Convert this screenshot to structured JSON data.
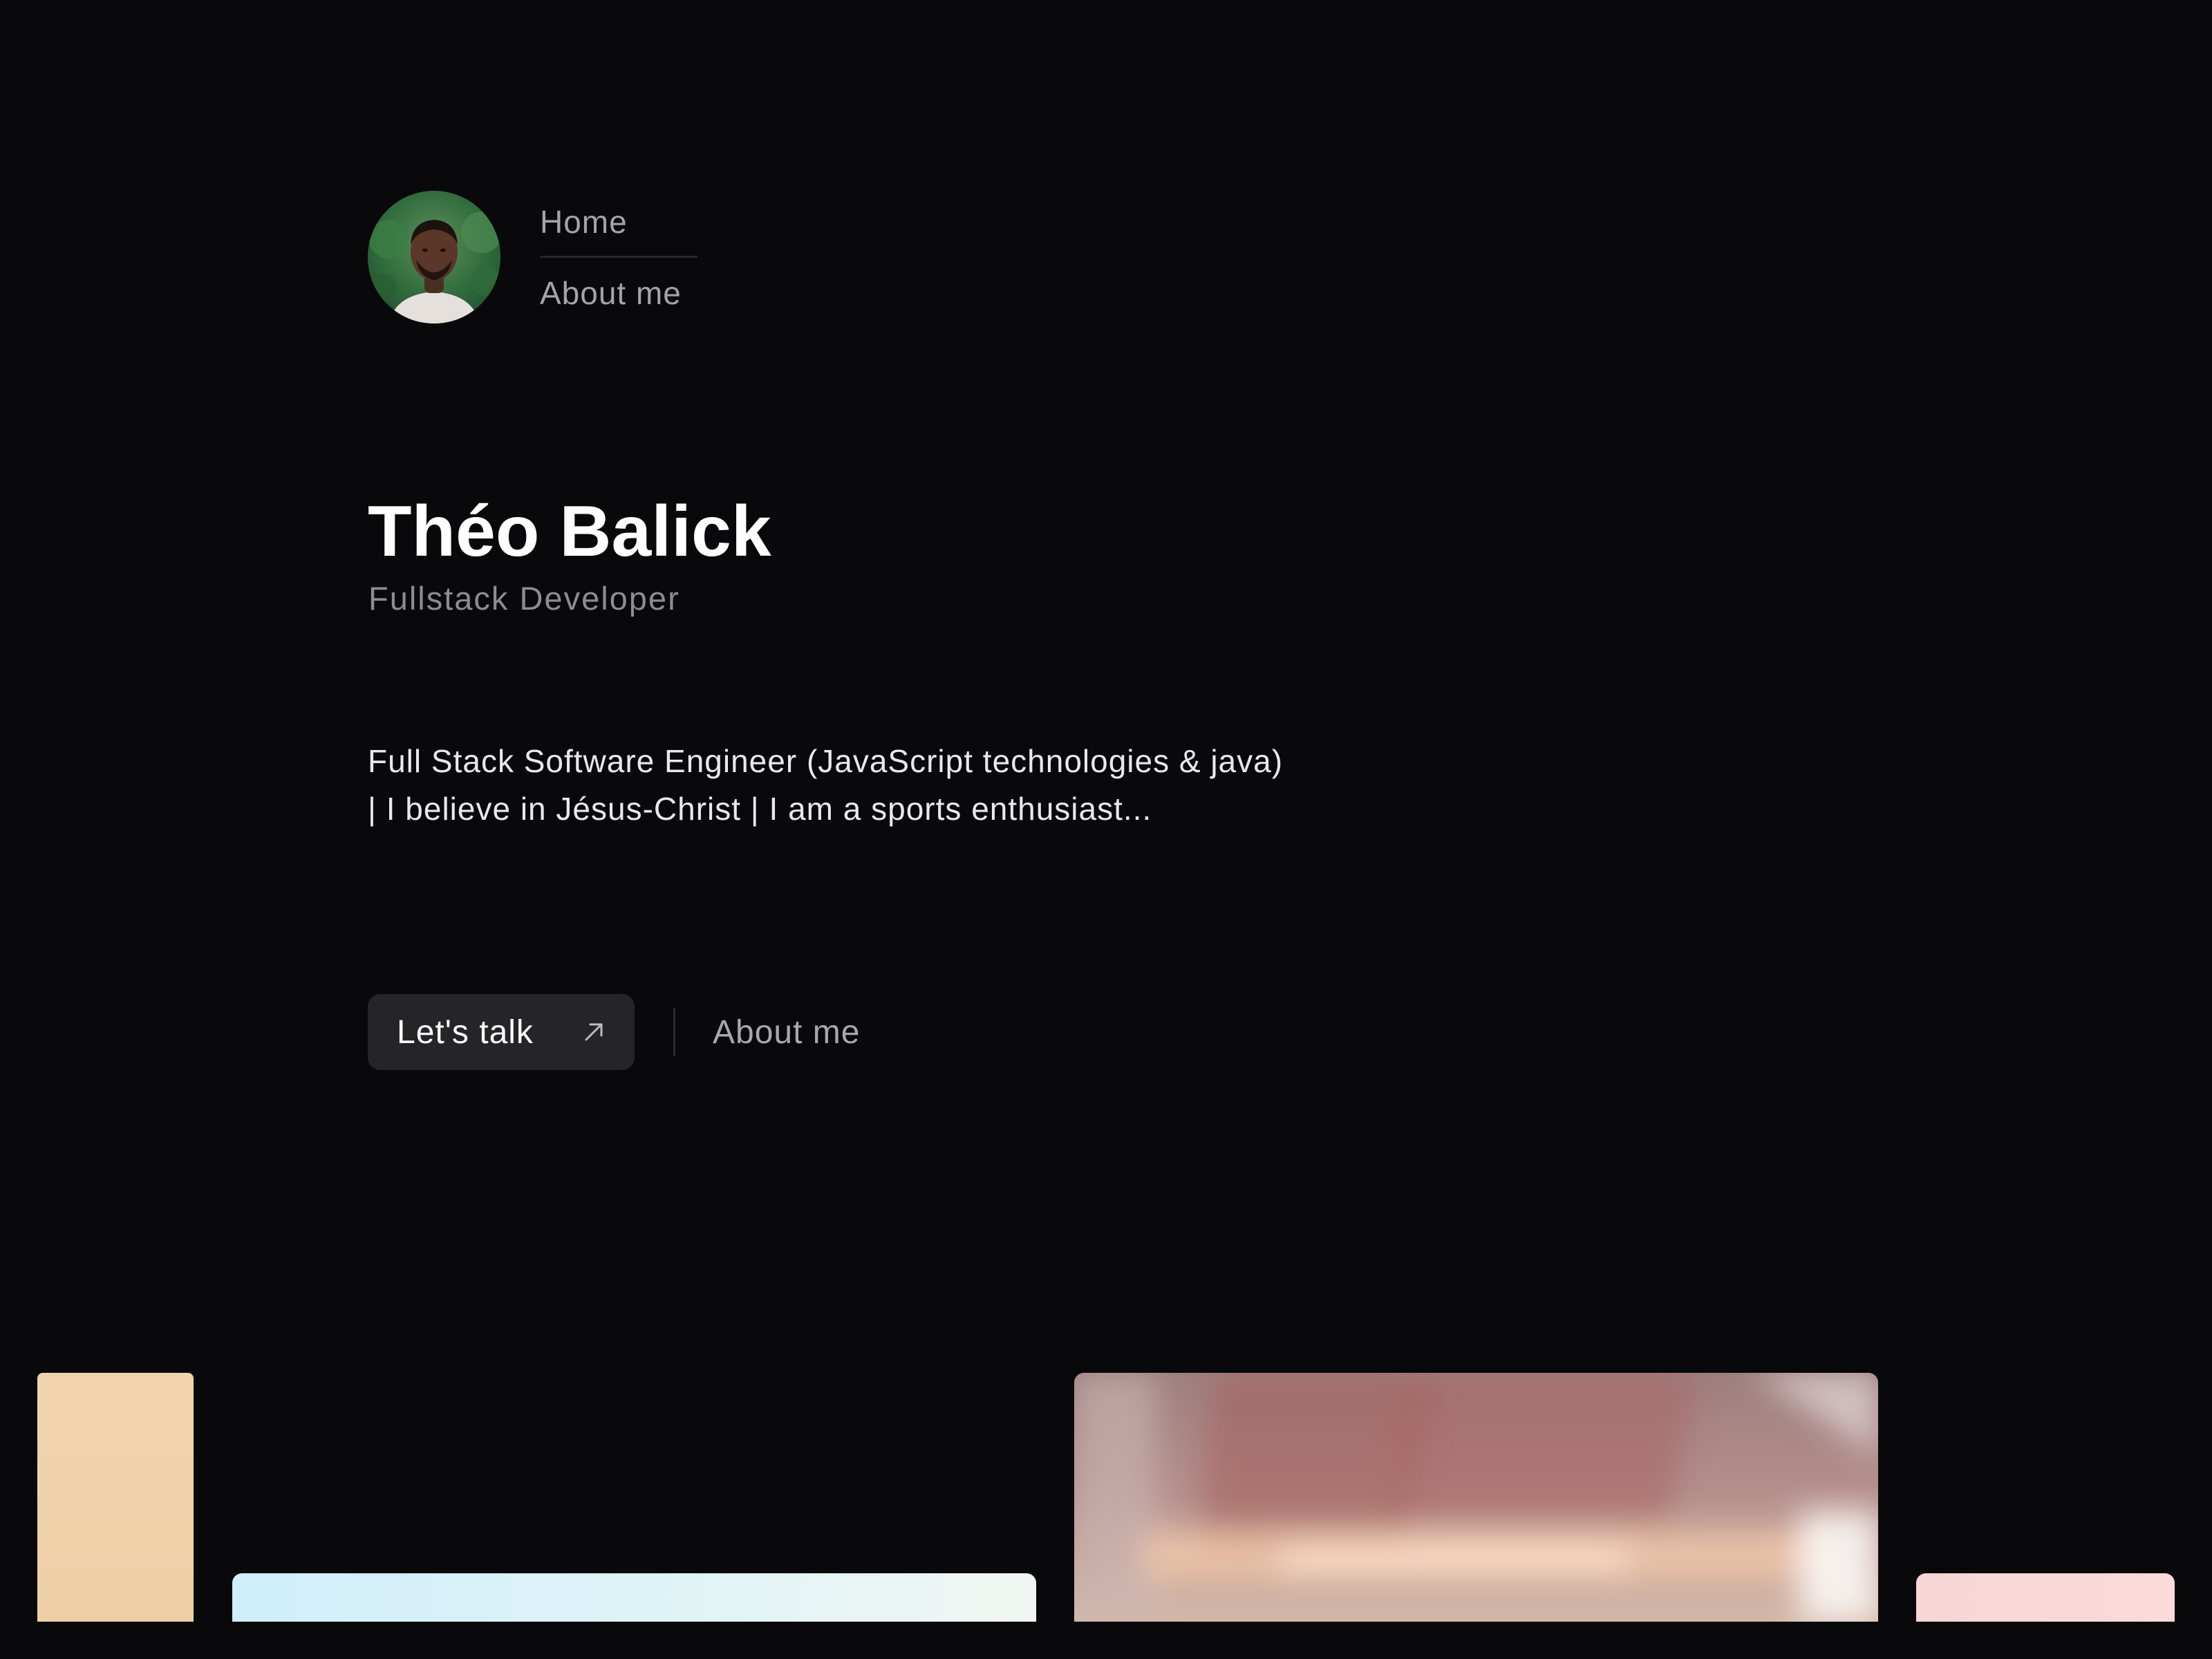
{
  "profile": {
    "avatar_alt": "Profile photo of Théo Balick"
  },
  "nav": {
    "items": [
      {
        "label": "Home"
      },
      {
        "label": "About me"
      }
    ]
  },
  "hero": {
    "name": "Théo Balick",
    "role": "Fullstack Developer",
    "bio": "Full Stack Software Engineer (JavaScript technologies & java) | I believe in Jésus-Christ | I am a sports enthusiast..."
  },
  "actions": {
    "primary_label": "Let's talk",
    "primary_icon": "arrow-up-right-icon",
    "secondary_label": "About me"
  },
  "colors": {
    "background": "#09090c",
    "button_bg": "#252528",
    "muted_text": "#a3a3a8",
    "body_text": "#e9e9ec"
  }
}
